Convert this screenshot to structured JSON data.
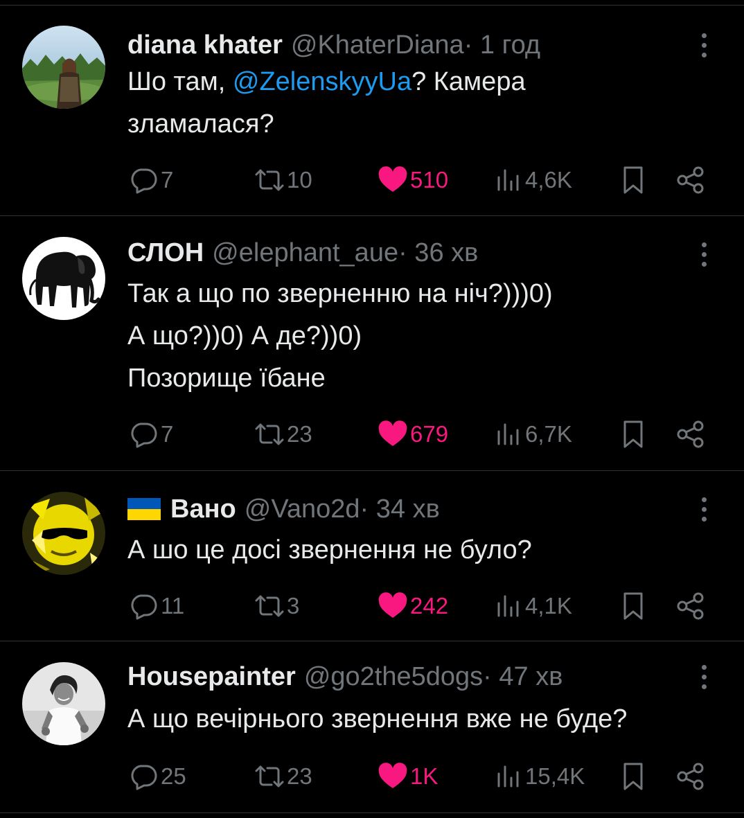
{
  "tweets": [
    {
      "name": "diana khater",
      "handle": "@KhaterDiana",
      "time": " · 1 год",
      "avatar": "avatar-photo-forest",
      "lines": [
        "Шо там, ",
        "@ZelenskyyUa",
        "? Камера",
        "зламалася?"
      ],
      "replies": "7",
      "retweets": "10",
      "likes": "510",
      "views": "4,6K"
    },
    {
      "name": "СЛОН",
      "handle": "@elephant_aue",
      "time": " · 36 хв",
      "avatar": "avatar-elephant",
      "lines": [
        "Так а що по зверненню на ніч?)))0)",
        "А що?))0) А де?))0)",
        "Позорище їбане"
      ],
      "replies": "7",
      "retweets": "23",
      "likes": "679",
      "views": "6,7K"
    },
    {
      "name": "Вано",
      "handle": "@Vano2d",
      "time": " · 34 хв",
      "avatar": "avatar-sunglasses-yellow",
      "flag": "ukraine-flag-icon",
      "lines": [
        "А шо це досі звернення не було?"
      ],
      "replies": "11",
      "retweets": "3",
      "likes": "242",
      "views": "4,1K"
    },
    {
      "name": "Housepainter",
      "handle": "@go2the5dogs",
      "time": " · 47 хв",
      "avatar": "avatar-photo-bw",
      "lines": [
        "А що вечірнього звернення вже не буде?"
      ],
      "replies": "25",
      "retweets": "23",
      "likes": "1K",
      "views": "15,4K"
    }
  ],
  "colors": {
    "background": "#000000",
    "text": "#e7e9ea",
    "muted": "#71767b",
    "mention": "#1d9bf0",
    "like": "#f91880",
    "divider": "#2f3336"
  },
  "icons": [
    "reply-icon",
    "retweet-icon",
    "like-icon",
    "views-icon",
    "bookmark-icon",
    "share-icon",
    "more-icon"
  ]
}
